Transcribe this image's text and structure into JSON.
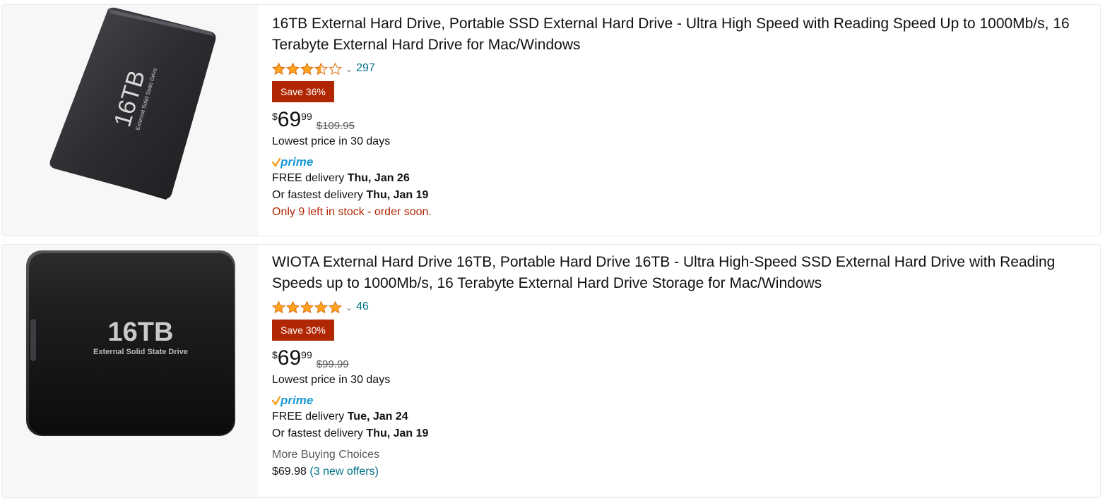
{
  "products": [
    {
      "image_label": "16TB",
      "image_sublabel": "External Solid State Drive",
      "title": "16TB External Hard Drive, Portable SSD External Hard Drive - Ultra High Speed with Reading Speed Up to 1000Mb/s, 16 Terabyte External Hard Drive for Mac/Windows",
      "rating": 3.5,
      "rating_count": "297",
      "save_badge": "Save 36%",
      "price_symbol": "$",
      "price_whole": "69",
      "price_fraction": "99",
      "list_price": "$109.95",
      "price_note": "Lowest price in 30 days",
      "prime_label": "prime",
      "delivery_label": "FREE delivery",
      "delivery_date": "Thu, Jan 26",
      "fastest_label": "Or fastest delivery",
      "fastest_date": "Thu, Jan 19",
      "stock_note": "Only 9 left in stock - order soon."
    },
    {
      "image_label": "16TB",
      "image_sublabel": "External Solid State Drive",
      "title": "WIOTA External Hard Drive 16TB, Portable Hard Drive 16TB - Ultra High-Speed SSD External Hard Drive with Reading Speeds up to 1000Mb/s, 16 Terabyte External Hard Drive Storage for Mac/Windows",
      "rating": 5,
      "rating_count": "46",
      "save_badge": "Save 30%",
      "price_symbol": "$",
      "price_whole": "69",
      "price_fraction": "99",
      "list_price": "$99.99",
      "price_note": "Lowest price in 30 days",
      "prime_label": "prime",
      "delivery_label": "FREE delivery",
      "delivery_date": "Tue, Jan 24",
      "fastest_label": "Or fastest delivery",
      "fastest_date": "Thu, Jan 19",
      "more_choices_label": "More Buying Choices",
      "more_choices_price": "$69.98",
      "more_choices_offers": "(3 new offers)"
    }
  ],
  "colors": {
    "star": "#ffa41c",
    "star_outline": "#de7921",
    "save_badge": "#b12704",
    "link": "#007185",
    "prime_check": "#f79e1b",
    "prime_text": "#1899d6"
  }
}
